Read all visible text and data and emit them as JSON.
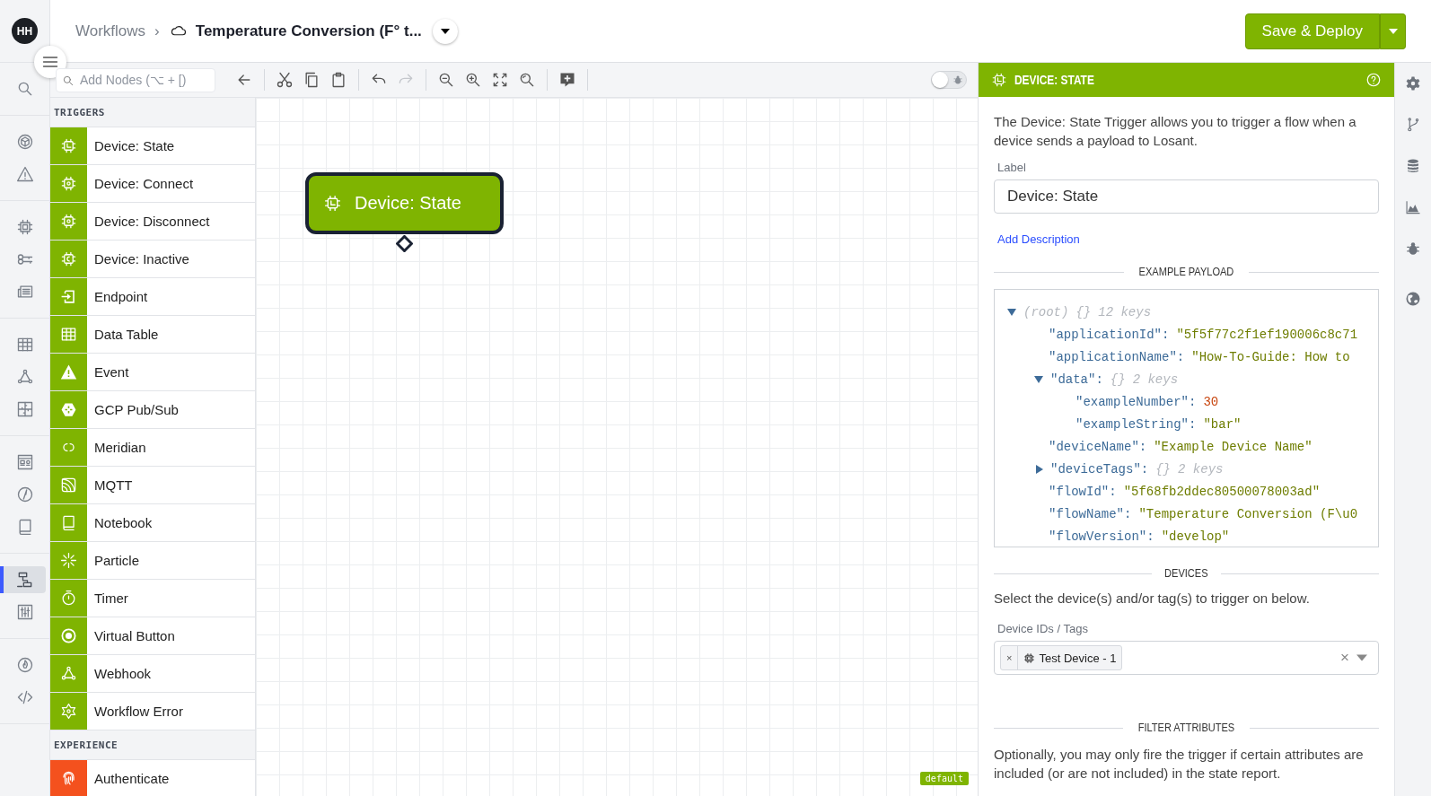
{
  "user": {
    "initials": "HH"
  },
  "rail_groups": [
    [
      {
        "kind": "search",
        "selected": false
      }
    ],
    [
      {
        "kind": "cube",
        "selected": false
      },
      {
        "kind": "warning",
        "selected": false
      }
    ],
    [
      {
        "kind": "chip",
        "selected": false
      },
      {
        "kind": "keys",
        "selected": false
      },
      {
        "kind": "list",
        "selected": false
      }
    ],
    [
      {
        "kind": "table",
        "selected": false
      },
      {
        "kind": "webhook",
        "selected": false
      },
      {
        "kind": "puzzle",
        "selected": false
      }
    ],
    [
      {
        "kind": "dashboard",
        "selected": false
      },
      {
        "kind": "compass",
        "selected": false
      },
      {
        "kind": "book",
        "selected": false
      }
    ],
    [
      {
        "kind": "workflow",
        "selected": true
      },
      {
        "kind": "sliders",
        "selected": false
      }
    ],
    [
      {
        "kind": "flame",
        "selected": false
      },
      {
        "kind": "code",
        "selected": false
      }
    ]
  ],
  "breadcrumb": {
    "parent": "Workflows",
    "separator": "›",
    "title": "Temperature Conversion (F° t..."
  },
  "deploy_button": {
    "label": "Save & Deploy"
  },
  "toolbar": {
    "search_placeholder": "Add Nodes (⌥ + [)",
    "groups": [
      [
        {
          "kind": "back",
          "disabled": false
        }
      ],
      [
        {
          "kind": "cut",
          "disabled": false
        },
        {
          "kind": "copy",
          "disabled": false
        },
        {
          "kind": "paste",
          "disabled": false
        }
      ],
      [
        {
          "kind": "undo",
          "disabled": false
        },
        {
          "kind": "redo",
          "disabled": true
        }
      ],
      [
        {
          "kind": "zoomout",
          "disabled": false
        },
        {
          "kind": "zoomin",
          "disabled": false
        },
        {
          "kind": "fit",
          "disabled": false
        },
        {
          "kind": "zoomsearch",
          "disabled": false
        }
      ],
      [
        {
          "kind": "comment",
          "disabled": false
        }
      ]
    ],
    "debug_toggle": {
      "on": false
    }
  },
  "palette": [
    {
      "title": "TRIGGERS",
      "items": [
        {
          "label": "Device: State",
          "kind": "chipstate",
          "color": "#7fb401"
        },
        {
          "label": "Device: Connect",
          "kind": "chipplug",
          "color": "#7fb401"
        },
        {
          "label": "Device: Disconnect",
          "kind": "chipplug",
          "color": "#7fb401"
        },
        {
          "label": "Device: Inactive",
          "kind": "chipmoon",
          "color": "#7fb401"
        },
        {
          "label": "Endpoint",
          "kind": "endpoint",
          "color": "#7fb401"
        },
        {
          "label": "Data Table",
          "kind": "table",
          "color": "#7fb401"
        },
        {
          "label": "Event",
          "kind": "warnfill",
          "color": "#7fb401"
        },
        {
          "label": "GCP Pub/Sub",
          "kind": "hexagon",
          "color": "#7fb401"
        },
        {
          "label": "Meridian",
          "kind": "meridian",
          "color": "#7fb401"
        },
        {
          "label": "MQTT",
          "kind": "feed",
          "color": "#7fb401"
        },
        {
          "label": "Notebook",
          "kind": "book",
          "color": "#7fb401"
        },
        {
          "label": "Particle",
          "kind": "burst",
          "color": "#7fb401"
        },
        {
          "label": "Timer",
          "kind": "timer",
          "color": "#7fb401"
        },
        {
          "label": "Virtual Button",
          "kind": "target",
          "color": "#7fb401"
        },
        {
          "label": "Webhook",
          "kind": "webhook",
          "color": "#7fb401"
        },
        {
          "label": "Workflow Error",
          "kind": "star",
          "color": "#7fb401"
        }
      ]
    },
    {
      "title": "EXPERIENCE",
      "items": [
        {
          "label": "Authenticate",
          "kind": "fingerprint",
          "color": "#f4511e"
        }
      ]
    }
  ],
  "canvas": {
    "nodes": [
      {
        "label": "Device: State",
        "kind": "chipstate",
        "selected": true
      }
    ],
    "version_badge": "default"
  },
  "panel": {
    "title": "DEVICE: STATE",
    "description": "The Device: State Trigger allows you to trigger a flow when a device sends a payload to Losant.",
    "label_field": {
      "label": "Label",
      "value": "Device: State"
    },
    "add_description": "Add Description",
    "payload_heading": "EXAMPLE PAYLOAD",
    "payload": {
      "label": "(root)",
      "summary": "{}",
      "count": "12 keys",
      "expanded": true,
      "children": [
        {
          "key": "\"applicationId\":",
          "value": "\"5f5f77c2f1ef190006c8c71",
          "kind": "string"
        },
        {
          "key": "\"applicationName\":",
          "value": "\"How-To-Guide: How to",
          "kind": "string"
        },
        {
          "key": "\"data\":",
          "summary": "{}",
          "count": "2 keys",
          "expanded": true,
          "children": [
            {
              "key": "\"exampleNumber\":",
              "value": "30",
              "kind": "number"
            },
            {
              "key": "\"exampleString\":",
              "value": "\"bar\"",
              "kind": "string"
            }
          ]
        },
        {
          "key": "\"deviceName\":",
          "value": "\"Example Device Name\"",
          "kind": "string"
        },
        {
          "key": "\"deviceTags\":",
          "summary": "{}",
          "count": "2 keys",
          "expanded": false
        },
        {
          "key": "\"flowId\":",
          "value": "\"5f68fb2ddec80500078003ad\"",
          "kind": "string"
        },
        {
          "key": "\"flowName\":",
          "value": "\"Temperature Conversion (F\\u0",
          "kind": "string"
        },
        {
          "key": "\"flowVersion\":",
          "value": "\"develop\"",
          "kind": "string"
        }
      ]
    },
    "devices_heading": "DEVICES",
    "devices_text": "Select the device(s) and/or tag(s) to trigger on below.",
    "devices_field": {
      "label": "Device IDs / Tags",
      "remove": "×",
      "clear": "×",
      "tags": [
        {
          "label": "Test Device - 1"
        }
      ]
    },
    "filter_heading": "FILTER ATTRIBUTES",
    "filter_text": "Optionally, you may only fire the trigger if certain attributes are included (or are not included) in the state report."
  },
  "right_rail": [
    {
      "kind": "gear"
    },
    {
      "kind": "branch"
    },
    {
      "kind": "database"
    },
    {
      "kind": "chart"
    },
    {
      "kind": "bug"
    },
    {
      "kind": "globe"
    }
  ]
}
